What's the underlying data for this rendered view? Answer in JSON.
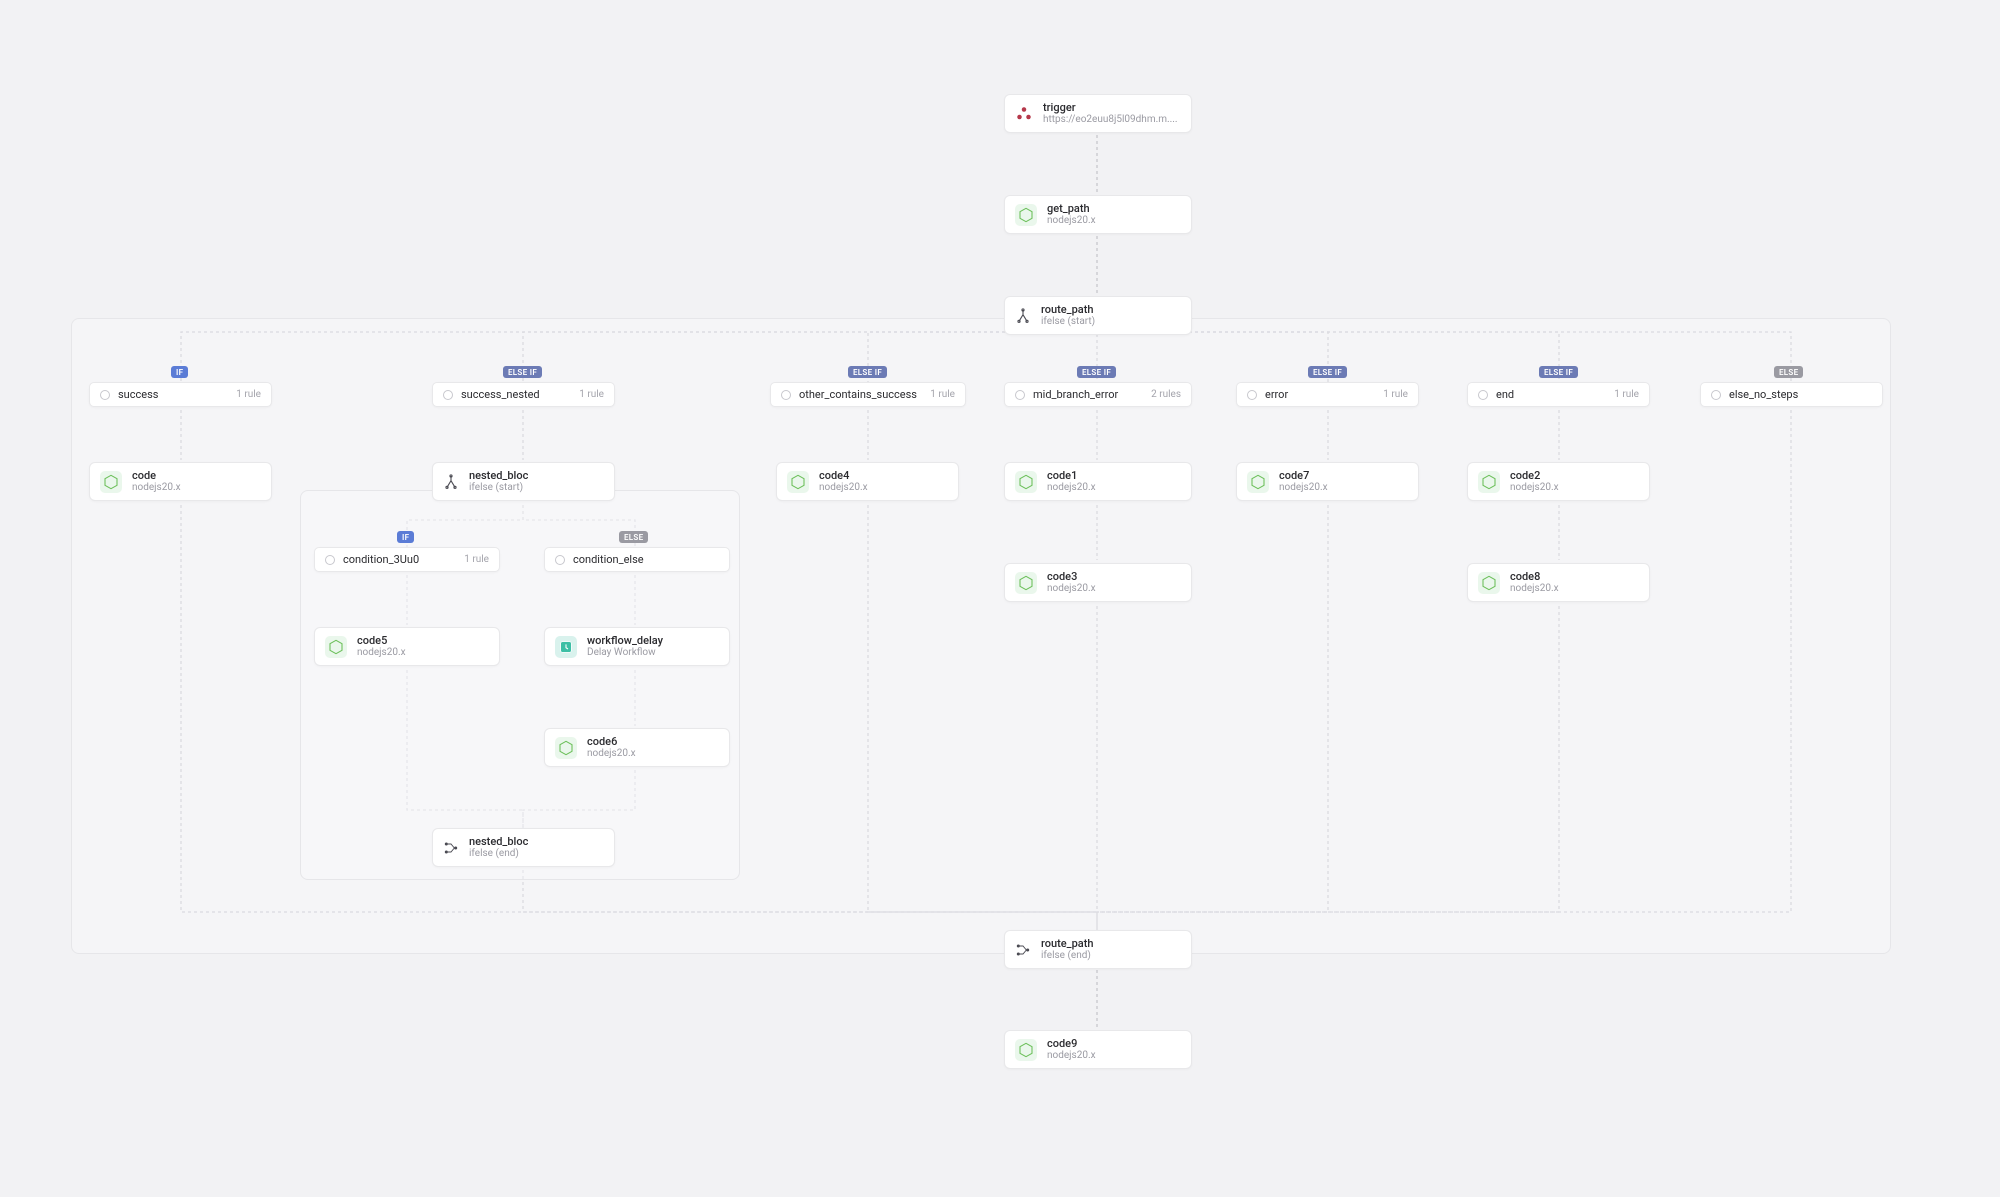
{
  "trigger": {
    "title": "trigger",
    "sub": "https://eo2euu8j5l09dhm.m...."
  },
  "get_path": {
    "title": "get_path",
    "sub": "nodejs20.x"
  },
  "route_path": {
    "title": "route_path",
    "sub": "ifelse (start)"
  },
  "route_path_end": {
    "title": "route_path",
    "sub": "ifelse (end)"
  },
  "nested_bloc": {
    "title": "nested_bloc",
    "sub": "ifelse (start)"
  },
  "nested_bloc_end": {
    "title": "nested_bloc",
    "sub": "ifelse (end)"
  },
  "code": {
    "title": "code",
    "sub": "nodejs20.x"
  },
  "code1": {
    "title": "code1",
    "sub": "nodejs20.x"
  },
  "code2": {
    "title": "code2",
    "sub": "nodejs20.x"
  },
  "code3": {
    "title": "code3",
    "sub": "nodejs20.x"
  },
  "code4": {
    "title": "code4",
    "sub": "nodejs20.x"
  },
  "code5": {
    "title": "code5",
    "sub": "nodejs20.x"
  },
  "code6": {
    "title": "code6",
    "sub": "nodejs20.x"
  },
  "code7": {
    "title": "code7",
    "sub": "nodejs20.x"
  },
  "code8": {
    "title": "code8",
    "sub": "nodejs20.x"
  },
  "code9": {
    "title": "code9",
    "sub": "nodejs20.x"
  },
  "workflow_delay": {
    "title": "workflow_delay",
    "sub": "Delay Workflow"
  },
  "cond": {
    "success": {
      "label": "success",
      "rules": "1 rule"
    },
    "success_nested": {
      "label": "success_nested",
      "rules": "1 rule"
    },
    "other_contains_success": {
      "label": "other_contains_success",
      "rules": "1 rule"
    },
    "mid_branch_error": {
      "label": "mid_branch_error",
      "rules": "2 rules"
    },
    "error": {
      "label": "error",
      "rules": "1 rule"
    },
    "end": {
      "label": "end",
      "rules": "1 rule"
    },
    "else_no_steps": {
      "label": "else_no_steps"
    },
    "condition_3uu0": {
      "label": "condition_3Uu0",
      "rules": "1 rule"
    },
    "condition_else": {
      "label": "condition_else"
    }
  },
  "pills": {
    "if": "IF",
    "elseif": "ELSE IF",
    "else": "ELSE"
  }
}
